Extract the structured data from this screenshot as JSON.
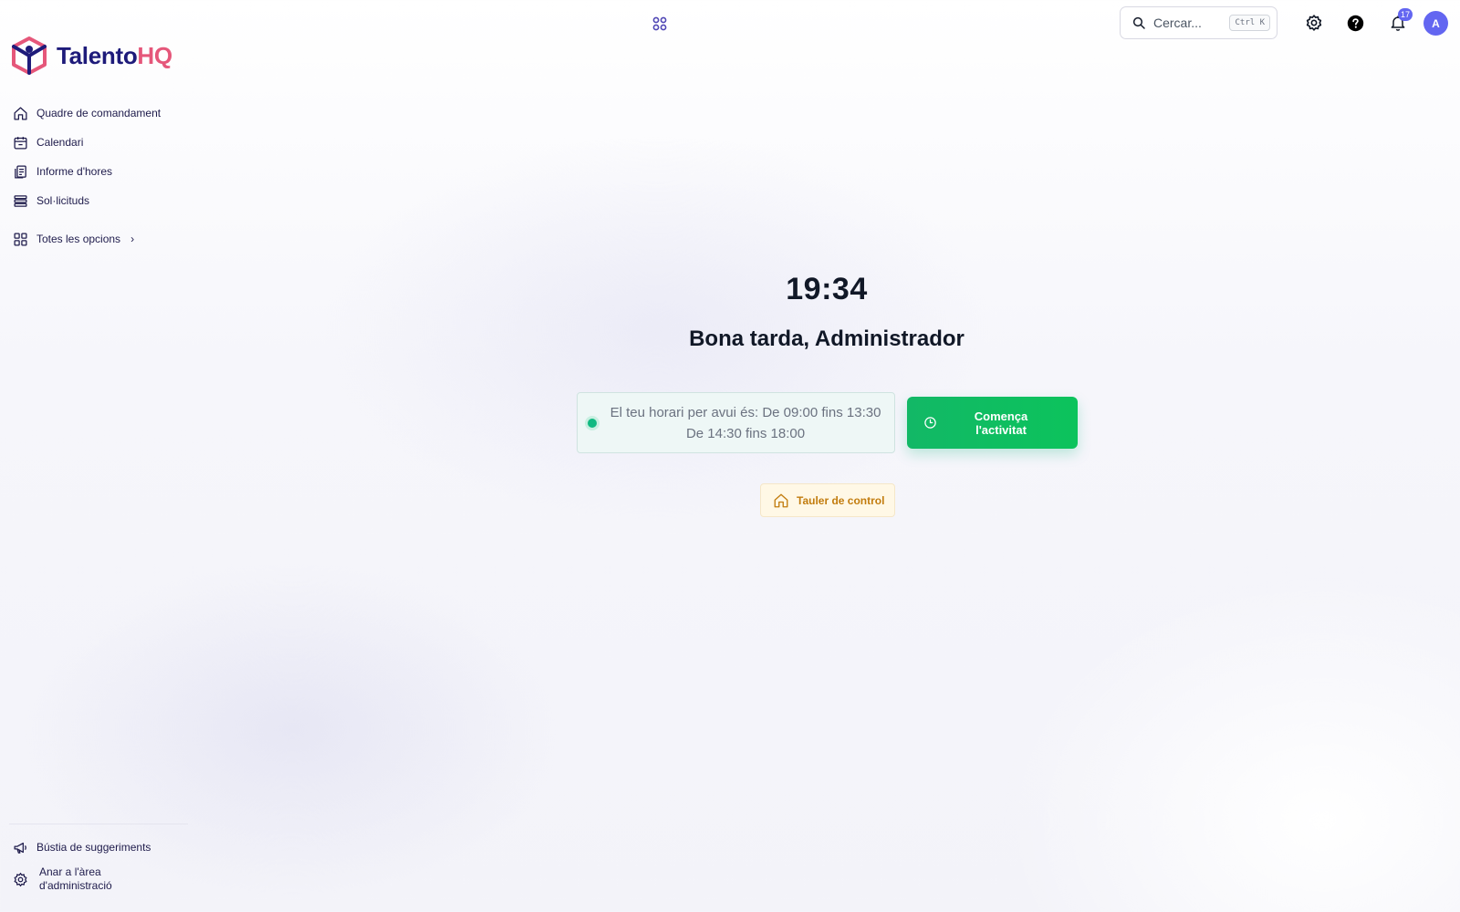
{
  "brand": {
    "name_part1": "Talento",
    "name_part2": "HQ",
    "primary_color": "#1e1b7a",
    "accent_color": "#e5577a"
  },
  "sidebar": {
    "items": [
      {
        "label": "Quadre de comandament",
        "icon": "home-icon"
      },
      {
        "label": "Calendari",
        "icon": "calendar-icon"
      },
      {
        "label": "Informe d'hores",
        "icon": "report-icon"
      },
      {
        "label": "Sol·licituds",
        "icon": "stack-icon"
      }
    ],
    "all_options": {
      "label": "Totes les opcions",
      "icon": "grid-icon",
      "chevron": "›"
    },
    "bottom": {
      "suggestions": {
        "label": "Bústia de suggeriments",
        "icon": "megaphone-icon"
      },
      "admin": {
        "label_line1": "Anar a l'àrea",
        "label_line2": "d'administració",
        "icon": "gear-icon"
      }
    }
  },
  "header": {
    "search": {
      "placeholder": "Cercar...",
      "shortcut": "Ctrl K"
    },
    "notifications_count": "17",
    "avatar_initial": "A",
    "accent_color": "#6366f1"
  },
  "main": {
    "clock": "19:34",
    "greeting": "Bona tarda, Administrador",
    "schedule": {
      "line1": "El teu horari per avui és: De 09:00 fins 13:30",
      "line2": "De 14:30 fins 18:00",
      "status_color": "#10b981"
    },
    "start_button": {
      "line1": "Comença",
      "line2": "l'activitat",
      "color": "#12b866"
    },
    "dashboard_button": {
      "label": "Tauler de control",
      "color": "#c27c0e"
    }
  }
}
